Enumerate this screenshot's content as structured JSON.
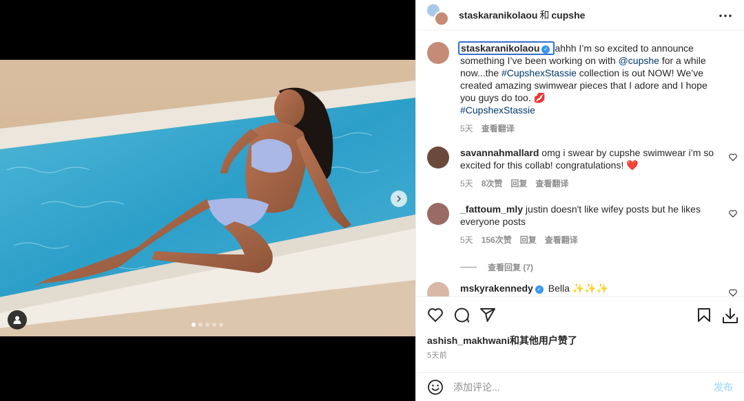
{
  "header": {
    "user1": "staskaranikolaou",
    "conjunction": "和",
    "user2": "cupshe",
    "more_icon": "more-horizontal-icon"
  },
  "caption": {
    "username": "staskaranikolaou",
    "text_before": "ahhh I’m so excited to announce something I’ve been working on with ",
    "mention": "@cupshe",
    "text_middle": " for a while now...the ",
    "hashtag1": "#CupshexStassie",
    "text_after": " collection is out NOW! We’ve created amazing swimwear pieces that I adore and I hope you guys do too. 💋",
    "hashtag2": "#CupshexStassie",
    "time": "5天",
    "translate": "查看翻译"
  },
  "comments": [
    {
      "username": "savannahmallard",
      "text": "omg i swear by cupshe swimwear i’m so excited for this collab! congratulations! ❤️",
      "time": "5天",
      "likes": "8次赞",
      "reply": "回复",
      "translate": "查看翻译"
    },
    {
      "username": "_fattoum_mly",
      "text": "justin doesn't like wifey posts but he likes everyone posts",
      "time": "5天",
      "likes": "156次赞",
      "reply": "回复",
      "translate": "查看翻译",
      "view_replies": "查看回复 (7)"
    },
    {
      "username": "mskyrakennedy",
      "text": "Bella ✨✨✨"
    }
  ],
  "footer": {
    "liked_by_user": "ashish_makhwani",
    "liked_by_suffix": "和其他用户赞了",
    "time_ago": "5天前",
    "comment_placeholder": "添加评论...",
    "post_label": "发布"
  },
  "colors": {
    "link": "#00376b",
    "verified": "#3897f0",
    "post_disabled": "#b2dffc"
  }
}
